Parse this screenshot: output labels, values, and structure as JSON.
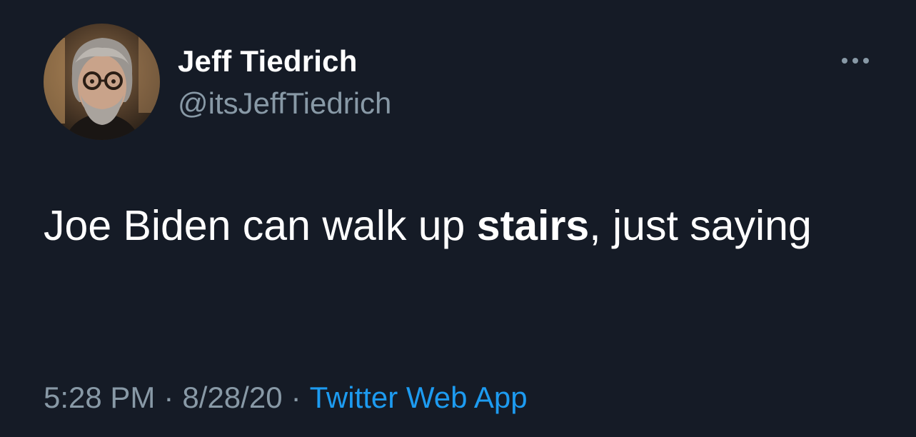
{
  "tweet": {
    "author": {
      "name": "Jeff Tiedrich",
      "handle": "@itsJeffTiedrich",
      "avatar": "profile-photo"
    },
    "more_icon": "more-horizontal-icon",
    "text": {
      "part1": "Joe Biden can walk up ",
      "bold": "stairs",
      "part2": ", just saying"
    },
    "meta": {
      "time": "5:28 PM",
      "separator": "·",
      "date": "8/28/20",
      "source": "Twitter Web App"
    },
    "colors": {
      "background": "#151b26",
      "primary_text": "#ffffff",
      "secondary_text": "#8899a6",
      "link": "#1d9bf0"
    }
  }
}
